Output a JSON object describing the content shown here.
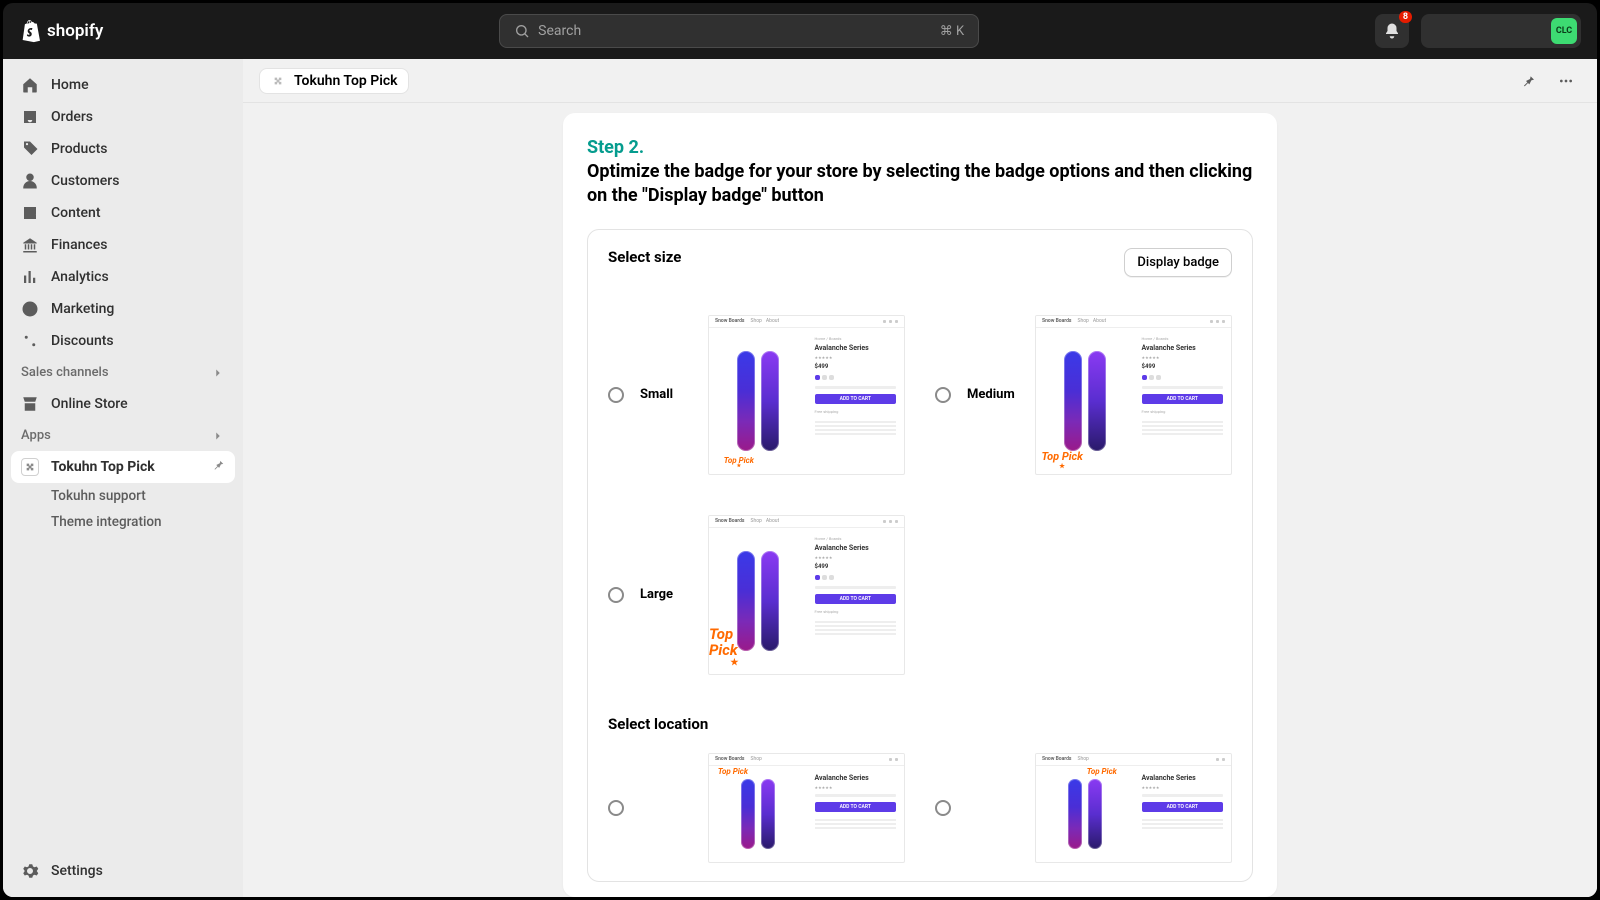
{
  "brand": "shopify",
  "search": {
    "placeholder": "Search",
    "shortcut": "⌘ K"
  },
  "notification_count": "8",
  "avatar_initials": "CLC",
  "nav": {
    "home": "Home",
    "orders": "Orders",
    "products": "Products",
    "customers": "Customers",
    "content": "Content",
    "finances": "Finances",
    "analytics": "Analytics",
    "marketing": "Marketing",
    "discounts": "Discounts"
  },
  "sections": {
    "sales_channels": "Sales channels",
    "online_store": "Online Store",
    "apps": "Apps"
  },
  "app": {
    "name": "Tokuhn Top Pick",
    "sub1": "Tokuhn support",
    "sub2": "Theme integration"
  },
  "settings": "Settings",
  "breadcrumb": "Tokuhn Top Pick",
  "step_label": "Step 2.",
  "step_title": "Optimize the badge for your store by selecting the badge options and then clicking on the \"Display badge\" button",
  "display_btn": "Display badge",
  "size": {
    "heading": "Select size",
    "options": [
      "Small",
      "Medium",
      "Large"
    ]
  },
  "location": {
    "heading": "Select location"
  },
  "preview": {
    "brand": "Snow Boards",
    "product_title": "Avalanche Series",
    "cta": "ADD TO CART",
    "badge_text": "Top Pick"
  }
}
